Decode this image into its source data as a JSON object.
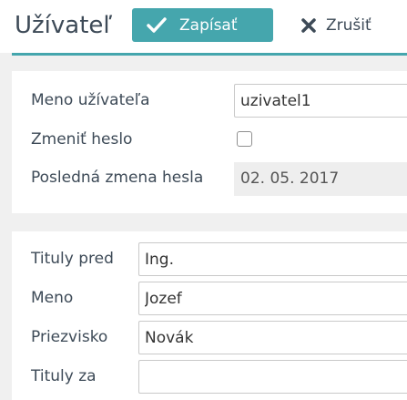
{
  "header": {
    "title": "Užívateľ",
    "save_label": "Zapísať",
    "cancel_label": "Zrušiť"
  },
  "account": {
    "username_label": "Meno užívateľa",
    "username_value": "uzivatel1",
    "change_password_label": "Zmeniť heslo",
    "change_password_checked": false,
    "last_change_label": "Posledná zmena hesla",
    "last_change_value": "02. 05. 2017"
  },
  "person": {
    "title_before_label": "Tituly pred",
    "title_before_value": "Ing.",
    "first_name_label": "Meno",
    "first_name_value": "Jozef",
    "last_name_label": "Priezvisko",
    "last_name_value": "Novák",
    "title_after_label": "Tituly za",
    "title_after_value": ""
  },
  "colors": {
    "accent": "#45a6ad",
    "text": "#3d4a57",
    "background": "#f0f0f0"
  },
  "icons": {
    "save": "check-icon",
    "cancel": "close-icon"
  }
}
